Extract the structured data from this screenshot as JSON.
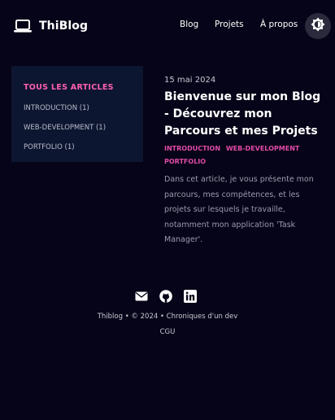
{
  "header": {
    "logo_text": "ThiBlog",
    "nav": [
      "Blog",
      "Projets",
      "À propos"
    ],
    "theme_toggle_icon": "brightness-icon"
  },
  "sidebar": {
    "title": "TOUS LES ARTICLES",
    "items": [
      "INTRODUCTION (1)",
      "WEB-DEVELOPMENT (1)",
      "PORTFOLIO (1)"
    ]
  },
  "post": {
    "date": "15 mai 2024",
    "title": "Bienvenue sur mon Blog - Découvrez mon Parcours et mes Projets",
    "tags": [
      "INTRODUCTION",
      "WEB-DEVELOPMENT",
      "PORTFOLIO"
    ],
    "excerpt": "Dans cet article, je vous présente mon parcours, mes compétences, et les projets sur lesquels je travaille, notamment mon application 'Task Manager'."
  },
  "footer": {
    "icons": [
      "mail-icon",
      "github-icon",
      "linkedin-icon"
    ],
    "line": "Thiblog • © 2024 • Chroniques d'un dev",
    "cgu": "CGU"
  },
  "colors": {
    "background": "#060418",
    "sidebar_bg": "#0d1630",
    "accent_pink": "#ff5fb0",
    "tag_pink": "#e24ba7",
    "text_muted": "#9a9cae"
  }
}
